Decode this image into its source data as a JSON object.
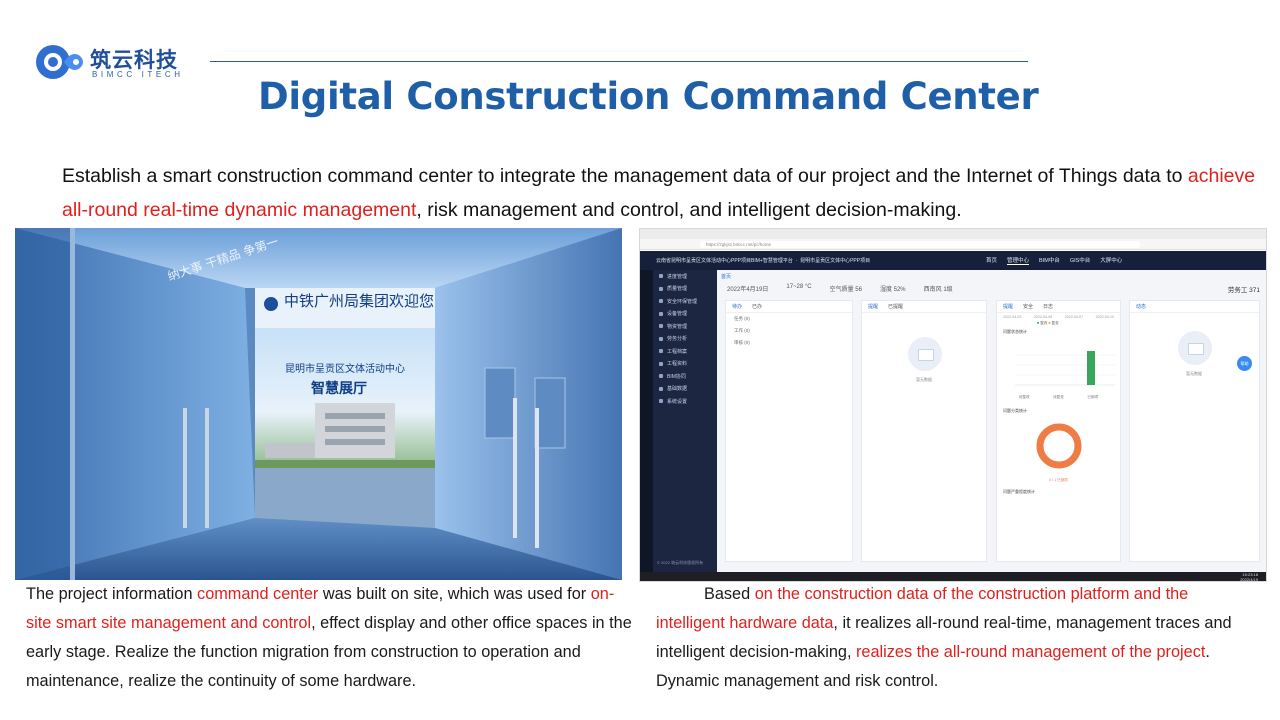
{
  "logo": {
    "name_cn": "筑云科技",
    "name_en": "BIMCC ITECH"
  },
  "title": "Digital Construction Command Center",
  "intro": {
    "part1": "Establish a smart construction command center to integrate the management data of our project and the Internet of Things data to ",
    "highlight": "achieve all-round real-time dynamic management",
    "part2": ", risk management and control, and intelligent decision-making."
  },
  "left_photo": {
    "sign_header": "中铁广州局集团欢迎您",
    "screen_line1": "昆明市呈贡区文体活动中心",
    "screen_line2": "智慧展厅",
    "wall_text": "纳大事 干精品 争第一"
  },
  "right_screenshot": {
    "url": "https://zgkjsz.bimcc.net/pc/home",
    "system_title": "云南省昆明市呈贡区文体活动中心PPP项目BIM+智慧管理平台",
    "project_selector": "昆明市呈贡区文体中心PPP项目",
    "nav": [
      "首页",
      "管理中心",
      "BIM中台",
      "GIS中台",
      "大屏中心"
    ],
    "nav_active": "管理中心",
    "sidebar": [
      "进度管理",
      "质量管理",
      "安全环保管理",
      "设备管理",
      "物资管理",
      "劳务分析",
      "工程档案",
      "工程资料",
      "BIM协同",
      "基础数据",
      "系统设置"
    ],
    "sidebar_footer": "© 2022 筑云科技版权所有",
    "date": "2022年4月19日",
    "temperature": "17~28 °C",
    "air": "空气质量 56",
    "humidity": "湿度 52%",
    "wind": "西南风 1级",
    "employee_count": "劳务工 371",
    "panel1_tabs": [
      "待办",
      "已办"
    ],
    "panel1_rows": [
      "任务 (0)",
      "工作 (0)",
      "审核 (0)"
    ],
    "panel2_tabs": [
      "提醒",
      "已提醒"
    ],
    "panel3_tabs": [
      "提醒",
      "安全",
      "日志"
    ],
    "panel3_dates": [
      "2022-04-03",
      "2022-04-05",
      "2022-04-07",
      "2022-04-10"
    ],
    "panel3_legend": [
      "整改",
      "复查"
    ],
    "panel3_sections": [
      "问题状态统计",
      "问题分类统计",
      "问题严重程度统计"
    ],
    "panel3_bar_labels": [
      "待整改",
      "待复查",
      "已销项"
    ],
    "panel3_ring_label": "0 / 1 已销项",
    "panel4_tabs": [
      "动态"
    ],
    "no_data": "暂无数据",
    "help_label": "帮助",
    "clock_time": "15:23:18",
    "clock_date": "2022/4/19"
  },
  "caption_left": {
    "p1": "The project information ",
    "h1": "command center",
    "p2": " was built on site, which was used for ",
    "h2": "on-site smart site management and control",
    "p3": ", effect display and other office spaces in the early stage. Realize the function migration from construction to operation and maintenance, realize the continuity of some hardware."
  },
  "caption_right": {
    "p1": "Based ",
    "h1": "on the construction data of the construction platform and the intelligent hardware data",
    "p2": ", it realizes all-round real-time, management traces and intelligent decision-making, ",
    "h2": "realizes the all-round management of the project",
    "p3": ". Dynamic management and risk control."
  },
  "colors": {
    "title_blue": "#1f5fa8",
    "highlight_red": "#e0201d",
    "rule_blue": "#2a5da8"
  }
}
